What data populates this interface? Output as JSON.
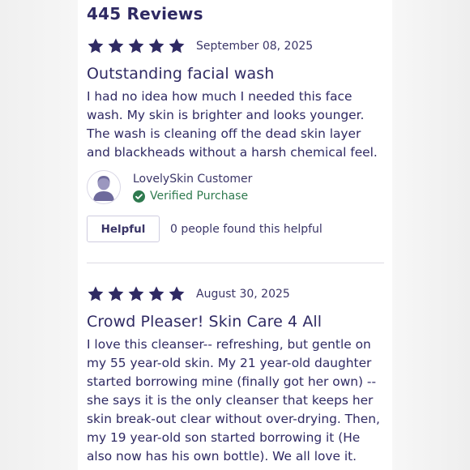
{
  "reviews_count": "445 Reviews",
  "colors": {
    "accent": "#2f2a63",
    "verified": "#2f7a4f",
    "star": "#2f2a63"
  },
  "reviews": [
    {
      "rating": 5,
      "date": "September 08, 2025",
      "title": "Outstanding facial wash",
      "body": "I had no idea how much I needed this face wash. My skin is brighter and looks younger. The wash is cleaning off the dead skin layer and blackheads without a harsh chemical feel.",
      "author": "LovelySkin Customer",
      "verified": "Verified Purchase",
      "helpful_label": "Helpful",
      "helpful_count": "0 people found this helpful"
    },
    {
      "rating": 5,
      "date": "August 30, 2025",
      "title": "Crowd Pleaser! Skin Care 4 All",
      "body": "I love this cleanser-- refreshing, but gentle on my 55 year-old skin. My 21 year-old daughter started borrowing mine (finally got her own) --she says it is the only cleanser that keeps her skin break-out clear without over-drying. Then, my 19 year-old son started borrowing it (He also now has his own bottle). We all love it."
    }
  ]
}
